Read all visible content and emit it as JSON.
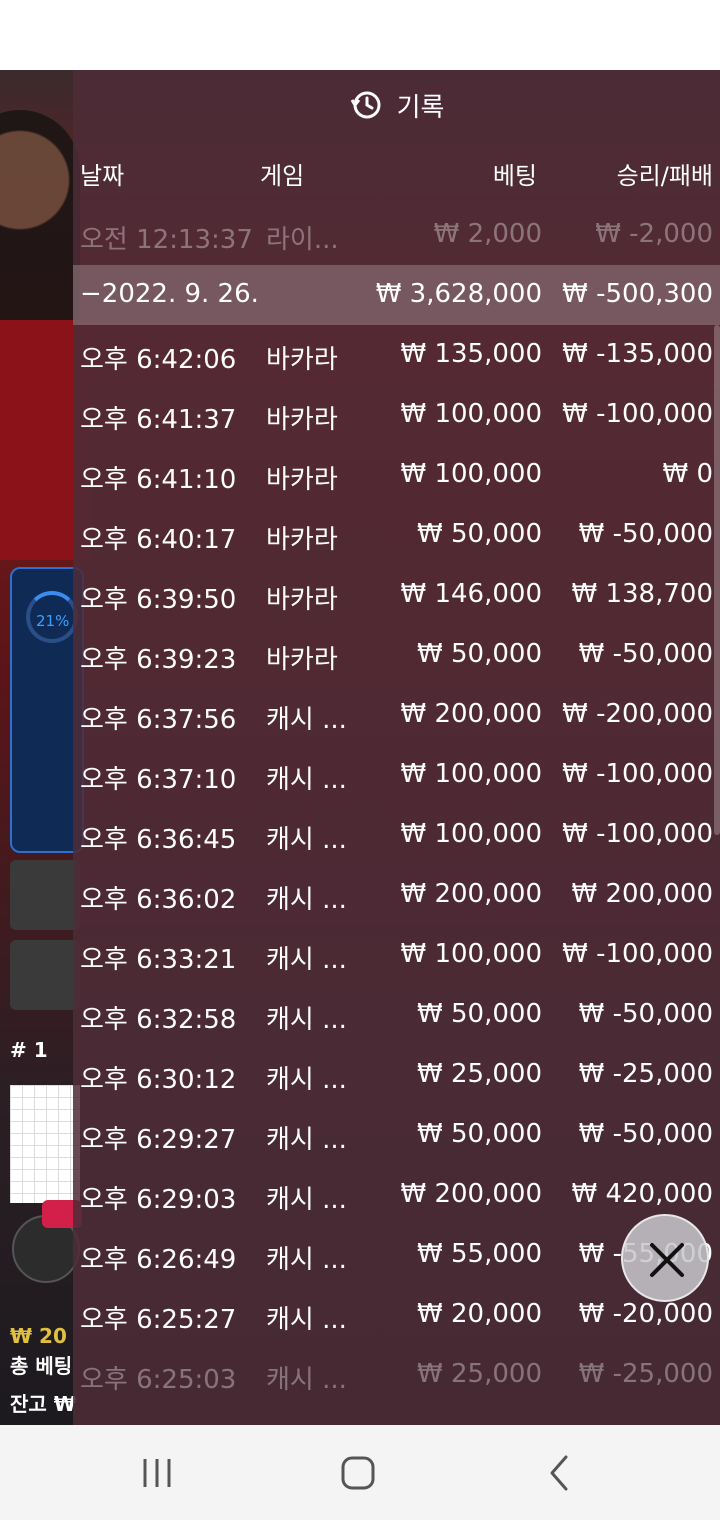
{
  "panel": {
    "title": "기록",
    "columns": {
      "date": "날짜",
      "game": "게임",
      "bet": "베팅",
      "result": "승리/패배"
    }
  },
  "rows": [
    {
      "date": "오전 12:13:37",
      "game": "라이...",
      "bet": "₩ 2,000",
      "result": "₩ -2,000",
      "faded": true
    },
    {
      "date": "−2022. 9. 26.",
      "game": "",
      "bet": "₩ 3,628,000",
      "result": "₩ -500,300",
      "group": true
    },
    {
      "date": "오후 6:42:06",
      "game": "바카라",
      "bet": "₩ 135,000",
      "result": "₩ -135,000"
    },
    {
      "date": "오후 6:41:37",
      "game": "바카라",
      "bet": "₩ 100,000",
      "result": "₩ -100,000"
    },
    {
      "date": "오후 6:41:10",
      "game": "바카라",
      "bet": "₩ 100,000",
      "result": "₩ 0"
    },
    {
      "date": "오후 6:40:17",
      "game": "바카라",
      "bet": "₩ 50,000",
      "result": "₩ -50,000"
    },
    {
      "date": "오후 6:39:50",
      "game": "바카라",
      "bet": "₩ 146,000",
      "result": "₩ 138,700"
    },
    {
      "date": "오후 6:39:23",
      "game": "바카라",
      "bet": "₩ 50,000",
      "result": "₩ -50,000"
    },
    {
      "date": "오후 6:37:56",
      "game": "캐시 ...",
      "bet": "₩ 200,000",
      "result": "₩ -200,000"
    },
    {
      "date": "오후 6:37:10",
      "game": "캐시 ...",
      "bet": "₩ 100,000",
      "result": "₩ -100,000"
    },
    {
      "date": "오후 6:36:45",
      "game": "캐시 ...",
      "bet": "₩ 100,000",
      "result": "₩ -100,000"
    },
    {
      "date": "오후 6:36:02",
      "game": "캐시 ...",
      "bet": "₩ 200,000",
      "result": "₩ 200,000"
    },
    {
      "date": "오후 6:33:21",
      "game": "캐시 ...",
      "bet": "₩ 100,000",
      "result": "₩ -100,000"
    },
    {
      "date": "오후 6:32:58",
      "game": "캐시 ...",
      "bet": "₩ 50,000",
      "result": "₩ -50,000"
    },
    {
      "date": "오후 6:30:12",
      "game": "캐시 ...",
      "bet": "₩ 25,000",
      "result": "₩ -25,000"
    },
    {
      "date": "오후 6:29:27",
      "game": "캐시 ...",
      "bet": "₩ 50,000",
      "result": "₩ -50,000"
    },
    {
      "date": "오후 6:29:03",
      "game": "캐시 ...",
      "bet": "₩ 200,000",
      "result": "₩ 420,000"
    },
    {
      "date": "오후 6:26:49",
      "game": "캐시 ...",
      "bet": "₩ 55,000",
      "result": "₩ -55,000"
    },
    {
      "date": "오후 6:25:27",
      "game": "캐시 ...",
      "bet": "₩ 20,000",
      "result": "₩ -20,000"
    },
    {
      "date": "오후 6:25:03",
      "game": "캐시 ...",
      "bet": "₩ 25,000",
      "result": "₩ -25,000",
      "faded": true
    }
  ],
  "background": {
    "progress_percent": "21%",
    "rank": "# 1",
    "balance_lines": [
      "₩ 20",
      "총 베팅",
      "잔고 ₩"
    ]
  },
  "icons": {
    "history": "history-icon",
    "close": "close-icon"
  },
  "colors": {
    "panel": "#4e2c38",
    "accent_blue": "#2e6fd0",
    "badge_red": "#d2204a"
  }
}
